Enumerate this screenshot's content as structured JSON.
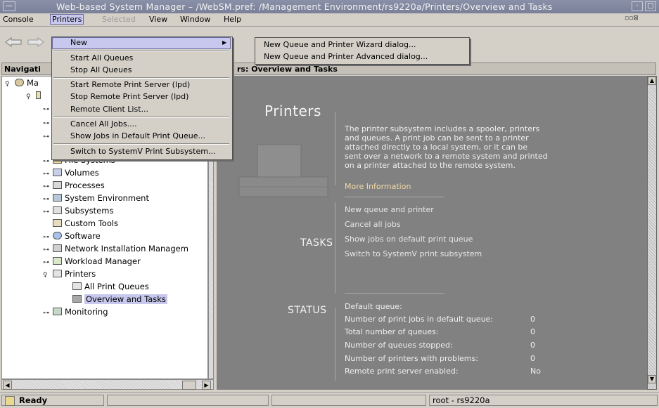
{
  "window": {
    "title": "Web-based System Manager – /WebSM.pref: /Management Environment/rs9220a/Printers/Overview and Tasks",
    "controls": [
      "minimize",
      "maximize"
    ]
  },
  "menubar": {
    "items": [
      {
        "label": "Console",
        "state": "normal"
      },
      {
        "label": "Printers",
        "state": "active"
      },
      {
        "label": "Selected",
        "state": "disabled"
      },
      {
        "label": "View",
        "state": "normal"
      },
      {
        "label": "Window",
        "state": "normal"
      },
      {
        "label": "Help",
        "state": "normal"
      }
    ]
  },
  "printers_menu": {
    "items": [
      {
        "label": "New",
        "has_submenu": true,
        "highlighted": true
      },
      {
        "label": "Start All Queues"
      },
      {
        "label": "Stop All Queues"
      },
      {
        "label": "Start Remote Print Server (lpd)"
      },
      {
        "label": "Stop Remote Print Server (lpd)"
      },
      {
        "label": "Remote Client List..."
      },
      {
        "label": "Cancel All Jobs...."
      },
      {
        "label": "Show Jobs in Default Print Queue..."
      },
      {
        "label": "Switch to SystemV Print Subsystem..."
      }
    ]
  },
  "new_submenu": {
    "items": [
      {
        "label": "New Queue and Printer Wizard dialog..."
      },
      {
        "label": "New Queue and Printer Advanced dialog..."
      }
    ]
  },
  "navigation": {
    "header": "Navigati",
    "root_label": "Ma",
    "tree": [
      {
        "label": "File Systems",
        "icon": "folder-icon"
      },
      {
        "label": "Volumes",
        "icon": "volumes-icon"
      },
      {
        "label": "Processes",
        "icon": "processes-icon"
      },
      {
        "label": "System Environment",
        "icon": "system-environment-icon"
      },
      {
        "label": "Subsystems",
        "icon": "subsystems-icon"
      },
      {
        "label": "Custom Tools",
        "icon": "custom-tools-icon"
      },
      {
        "label": "Software",
        "icon": "software-icon"
      },
      {
        "label": "Network Installation Managem",
        "icon": "network-install-icon"
      },
      {
        "label": "Workload Manager",
        "icon": "workload-icon"
      },
      {
        "label": "Printers",
        "icon": "printer-icon"
      },
      {
        "label": "All Print Queues",
        "icon": "print-queue-icon"
      },
      {
        "label": "Overview and Tasks",
        "icon": "overview-icon",
        "selected": true
      },
      {
        "label": "Monitoring",
        "icon": "monitoring-icon"
      }
    ]
  },
  "content": {
    "header": "rs: Overview and Tasks",
    "title": "Printers",
    "description": [
      "The printer subsystem includes a spooler, printers",
      "and queues. A print job can be sent to a printer",
      "attached directly to a local system, or it can be",
      "sent over a network to a remote system and printed",
      "on a printer attached to the remote system."
    ],
    "more_info": "More Information",
    "tasks_label": "TASKS",
    "tasks": [
      "New queue and printer",
      "Cancel all jobs",
      "Show jobs on default print queue",
      "Switch to SystemV print subsystem"
    ],
    "status_label": "STATUS",
    "status": [
      {
        "label": "Default queue:",
        "value": ""
      },
      {
        "label": "Number of print jobs in default queue:",
        "value": "0"
      },
      {
        "label": "Total number of queues:",
        "value": "0"
      },
      {
        "label": "Number of queues stopped:",
        "value": "0"
      },
      {
        "label": "Number of printers with problems:",
        "value": "0"
      },
      {
        "label": "Remote print server enabled:",
        "value": "No"
      }
    ]
  },
  "statusbar": {
    "ready": "Ready",
    "user": "root - rs9220a"
  },
  "colors": {
    "titlebar": "#7a8098",
    "content_bg": "#818181",
    "selection": "#c8c8ee",
    "more_info": "#f0d8a8"
  }
}
